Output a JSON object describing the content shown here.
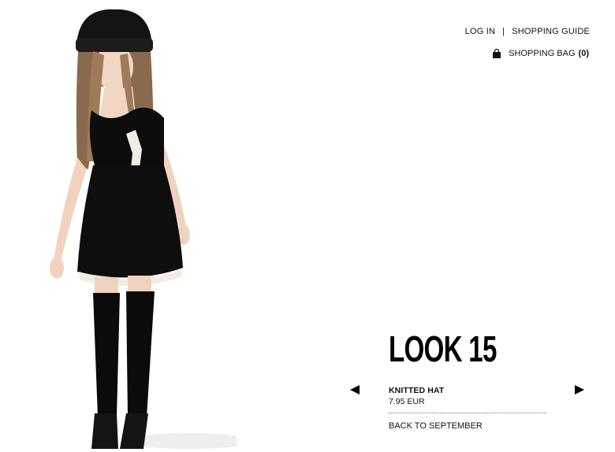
{
  "nav": {
    "login_label": "LOG IN",
    "separator": "|",
    "guide_label": "SHOPPING GUIDE"
  },
  "bag": {
    "label": "SHOPPING BAG",
    "count": "(0)"
  },
  "look": {
    "title": "LOOK 15",
    "item_name": "KNITTED HAT",
    "item_price": "7.95 EUR",
    "back_label": "BACK TO SEPTEMBER"
  },
  "icons": {
    "bag": "shopping-bag-icon",
    "prev": "arrow-left-icon",
    "next": "arrow-right-icon"
  },
  "colors": {
    "text": "#111111",
    "background": "#ffffff"
  }
}
